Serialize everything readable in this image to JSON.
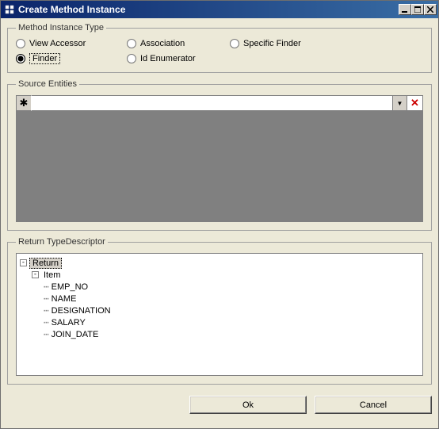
{
  "window": {
    "title": "Create Method Instance"
  },
  "methodInstanceType": {
    "legend": "Method Instance Type",
    "options": {
      "viewAccessor": "View Accessor",
      "association": "Association",
      "specificFinder": "Specific Finder",
      "finder": "Finder",
      "idEnumerator": "Id Enumerator"
    },
    "selected": "finder"
  },
  "sourceEntities": {
    "legend": "Source Entities",
    "rowMarker": "✱",
    "value": ""
  },
  "returnTypeDescriptor": {
    "legend": "Return TypeDescriptor",
    "tree": {
      "root": "Return",
      "item": "Item",
      "fields": [
        "EMP_NO",
        "NAME",
        "DESIGNATION",
        "SALARY",
        "JOIN_DATE"
      ]
    }
  },
  "buttons": {
    "ok": "Ok",
    "cancel": "Cancel"
  }
}
